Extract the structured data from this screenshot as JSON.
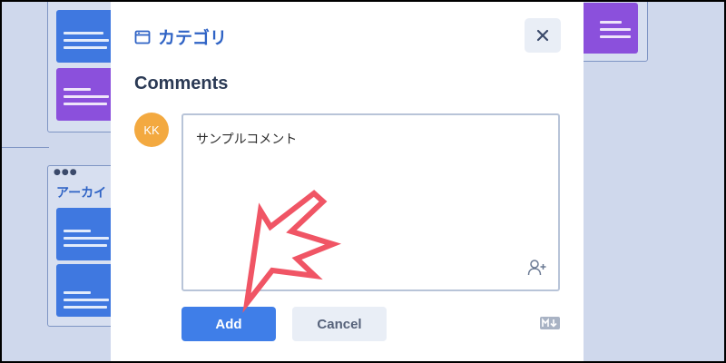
{
  "modal": {
    "title": "カテゴリ",
    "close_icon": "close-icon",
    "section_title": "Comments",
    "avatar_initials": "KK",
    "comment_value": "サンプルコメント",
    "add_label": "Add",
    "cancel_label": "Cancel"
  },
  "board": {
    "column_title": "アーカイ"
  },
  "colors": {
    "accent": "#2f63c5",
    "primary_button": "#3f7ee8",
    "avatar": "#f3a940",
    "card_blue": "#3f78e0",
    "card_purple": "#8b50dc",
    "annotation_arrow": "#f05565"
  },
  "icons": [
    "category-icon",
    "close-icon",
    "mention-user-icon",
    "markdown-icon",
    "annotation-arrow"
  ]
}
